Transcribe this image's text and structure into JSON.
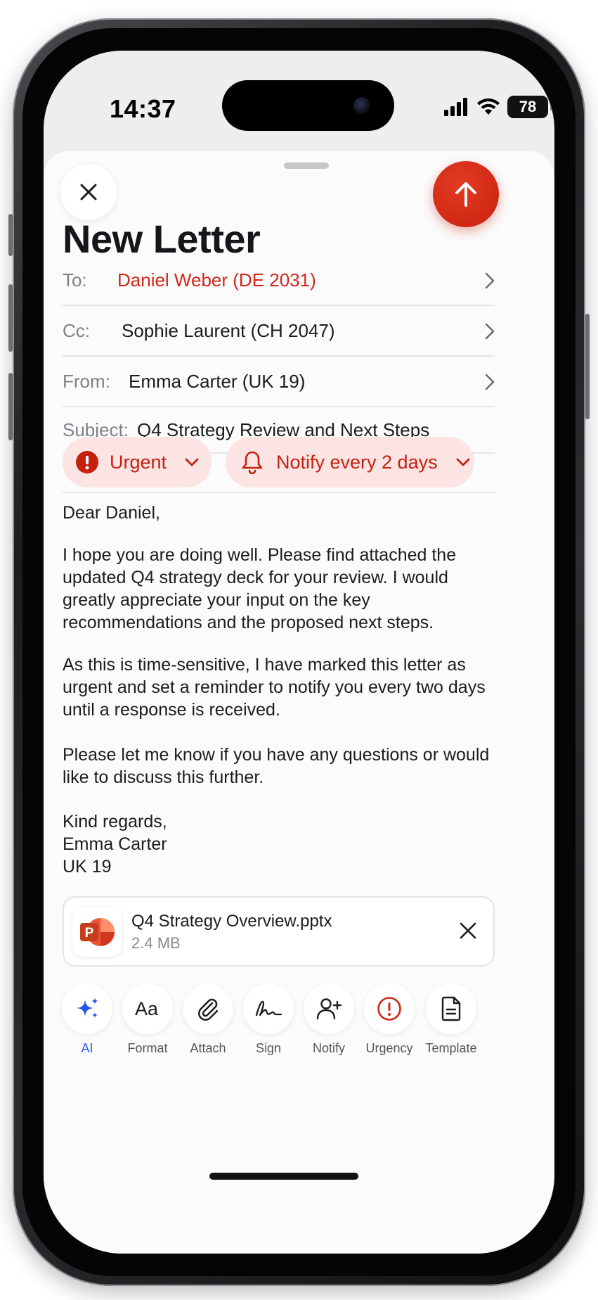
{
  "status": {
    "time": "14:37",
    "battery": "78"
  },
  "header": {
    "title": "New Letter"
  },
  "fields": {
    "to": {
      "label": "To:",
      "value": "Daniel Weber (DE 2031)"
    },
    "cc": {
      "label": "Cc:",
      "value": "Sophie Laurent (CH 2047)"
    },
    "from": {
      "label": "From:",
      "value": "Emma Carter (UK 19)"
    },
    "subject": {
      "label": "Subject:",
      "value": "Q4 Strategy Review and Next Steps"
    }
  },
  "chips": {
    "urgency": "Urgent",
    "reminder": "Notify every 2 days"
  },
  "letter": {
    "greeting": "Dear Daniel,",
    "p1": "I hope you are doing well. Please find attached the updated Q4 strategy deck for your review. I would greatly appreciate your input on the key recommendations and the proposed next steps.",
    "p2": "As this is time-sensitive, I have marked this letter as urgent and set a reminder to notify you every two days until a response is received.",
    "p3": "Please let me know if you have any questions or would like to discuss this further.",
    "closing": "Kind regards,",
    "name": "Emma Carter",
    "office": "UK 19"
  },
  "attachment": {
    "name": "Q4 Strategy Overview.pptx",
    "size": "2.4 MB",
    "icon": "powerpoint-icon"
  },
  "toolbar": {
    "items": [
      {
        "label": "AI",
        "icon": "sparkle-icon"
      },
      {
        "label": "Format",
        "icon": "text-format-icon"
      },
      {
        "label": "Attach",
        "icon": "paperclip-icon"
      },
      {
        "label": "Sign",
        "icon": "signature-icon"
      },
      {
        "label": "Notify",
        "icon": "person-add-icon"
      },
      {
        "label": "Urgency",
        "icon": "exclamation-circle-icon"
      },
      {
        "label": "Template",
        "icon": "document-icon"
      }
    ]
  },
  "colors": {
    "accent_red": "#d3261a",
    "chip_bg": "#fbe4e3",
    "ai_blue": "#2a55e8"
  }
}
